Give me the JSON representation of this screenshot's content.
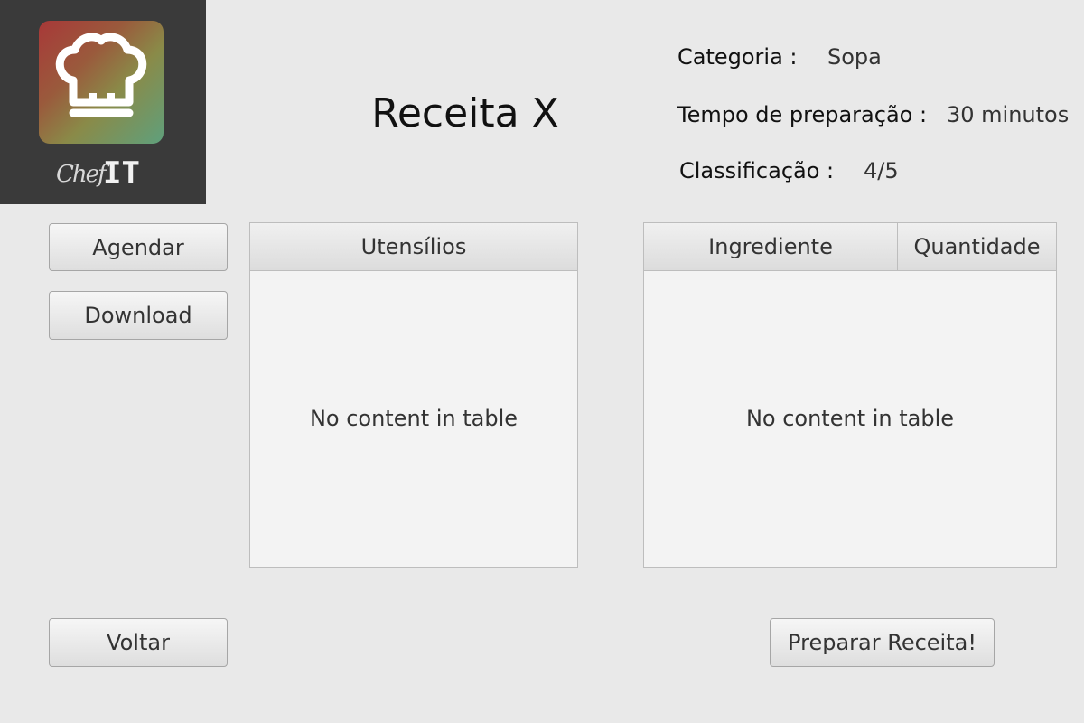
{
  "logo": {
    "script_text": "Chef",
    "brand_text": "IT"
  },
  "recipe": {
    "title": "Receita X"
  },
  "info": {
    "category_label": "Categoria :",
    "category_value": "Sopa",
    "time_label": "Tempo de preparação :",
    "time_value": "30 minutos",
    "rating_label": "Classificação :",
    "rating_value": "4/5"
  },
  "buttons": {
    "schedule": "Agendar",
    "download": "Download",
    "back": "Voltar",
    "prepare": "Preparar Receita!"
  },
  "utensils_table": {
    "columns": [
      "Utensílios"
    ],
    "empty_text": "No content in table"
  },
  "ingredients_table": {
    "columns": [
      "Ingrediente",
      "Quantidade"
    ],
    "empty_text": "No content in table"
  },
  "colors": {
    "logo_gradient_start": "#a83838",
    "logo_gradient_end": "#5fa07c",
    "logo_panel": "#3a3a3a",
    "background": "#e9e9e9"
  }
}
